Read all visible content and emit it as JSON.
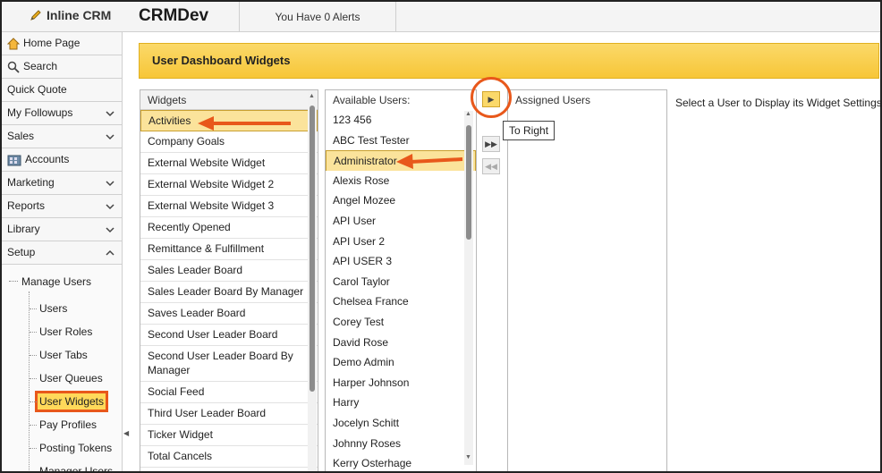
{
  "header": {
    "logo_text": "Inline CRM",
    "app_name": "CRMDev",
    "alerts_text": "You Have 0 Alerts"
  },
  "sidebar": {
    "items": [
      {
        "label": "Home Page",
        "icon": "home-icon"
      },
      {
        "label": "Search",
        "icon": "search-icon"
      },
      {
        "label": "Quick Quote"
      },
      {
        "label": "My Followups",
        "chevron": "down"
      },
      {
        "label": "Sales",
        "chevron": "down"
      },
      {
        "label": "Accounts",
        "icon": "accounts-icon"
      },
      {
        "label": "Marketing",
        "chevron": "down"
      },
      {
        "label": "Reports",
        "chevron": "down"
      },
      {
        "label": "Library",
        "chevron": "down"
      },
      {
        "label": "Setup",
        "chevron": "up"
      }
    ],
    "tree_root": "Manage Users",
    "tree_children": [
      "Users",
      "User Roles",
      "User Tabs",
      "User Queues",
      "User Widgets",
      "Pay Profiles",
      "Posting Tokens",
      "Manager Users"
    ],
    "selected_child": "User Widgets"
  },
  "main": {
    "title": "User Dashboard Widgets",
    "widgets_header": "Widgets",
    "widgets": [
      "Activities",
      "Company Goals",
      "External Website Widget",
      "External Website Widget 2",
      "External Website Widget 3",
      "Recently Opened",
      "Remittance & Fulfillment",
      "Sales Leader Board",
      "Sales Leader Board By Manager",
      "Saves Leader Board",
      "Second User Leader Board",
      "Second User Leader Board By Manager",
      "Social Feed",
      "Third User Leader Board",
      "Ticker Widget",
      "Total Cancels"
    ],
    "selected_widget": "Activities",
    "available_header": "Available Users:",
    "users": [
      "123 456",
      "ABC Test Tester",
      "Administrator",
      "Alexis Rose",
      "Angel Mozee",
      "API User",
      "API User 2",
      "API USER 3",
      "Carol Taylor",
      "Chelsea France",
      "Corey Test",
      "David Rose",
      "Demo Admin",
      "Harper Johnson",
      "Harry",
      "Jocelyn Schitt",
      "Johnny Roses",
      "Kerry Osterhage"
    ],
    "selected_user": "Administrator",
    "assigned_header": "Assigned Users",
    "tooltip": "To Right",
    "info_text": "Select a User to Display its Widget Settings."
  },
  "colors": {
    "accent_yellow": "#f7c637",
    "annotation_orange": "#e8581b",
    "selection": "#fbe39b"
  }
}
